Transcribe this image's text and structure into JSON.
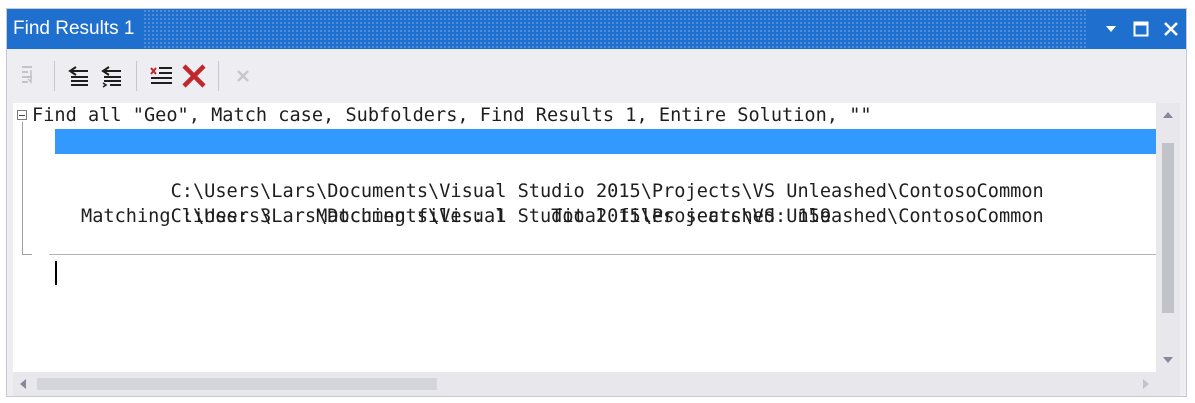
{
  "window": {
    "title": "Find Results 1",
    "controls": [
      {
        "name": "dropdown-icon",
        "glyph": "▾"
      },
      {
        "name": "maximize-icon",
        "glyph": "□"
      },
      {
        "name": "close-icon",
        "glyph": "✕"
      }
    ]
  },
  "toolbar": {
    "buttons": [
      {
        "name": "go-to-location-button",
        "icon": "goto-location-icon",
        "enabled": false
      },
      {
        "name": "previous-location-button",
        "icon": "previous-location-icon",
        "enabled": true
      },
      {
        "name": "next-location-button",
        "icon": "next-location-icon",
        "enabled": true
      },
      {
        "name": "clear-all-button",
        "icon": "clear-all-icon",
        "enabled": true
      },
      {
        "name": "stop-find-button",
        "icon": "stop-find-icon",
        "enabled": false
      }
    ]
  },
  "results": {
    "header": "Find all \"Geo\", Match case, Subfolders, Find Results 1, Entire Solution, \"\"",
    "items": [
      {
        "text": "C:\\Users\\Lars\\Documents\\Visual Studio 2015\\Projects\\VS Unleashed\\ContosoCommon",
        "selected": true
      },
      {
        "text": "C:\\Users\\Lars\\Documents\\Visual Studio 2015\\Projects\\VS Unleashed\\ContosoCommon",
        "selected": false
      },
      {
        "text": "C:\\Users\\Lars\\Documents\\Visual Studio 2015\\Projects\\VS Unleashed\\ContosoCommon",
        "selected": false
      }
    ],
    "summary": "Matching lines: 3    Matching files: 1    Total files searched: 159"
  },
  "colors": {
    "title_bar": "#1f6fcf",
    "selection": "#3399ff",
    "clear_x": "#c0282c"
  }
}
